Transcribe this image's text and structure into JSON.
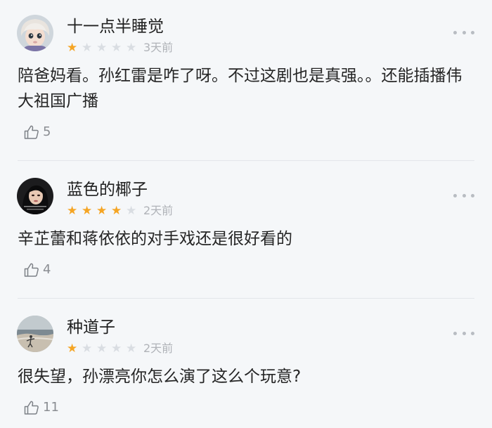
{
  "reviews": [
    {
      "username": "十一点半睡觉",
      "rating": 1,
      "max_rating": 5,
      "time": "3天前",
      "content": "陪爸妈看。孙红雷是咋了呀。不过这剧也是真强。。还能插播伟大祖国广播",
      "likes": "5",
      "avatar_icon": "doll-avatar"
    },
    {
      "username": "蓝色的椰子",
      "rating": 4,
      "max_rating": 5,
      "time": "2天前",
      "content": "辛芷蕾和蒋依依的对手戏还是很好看的",
      "likes": "4",
      "avatar_icon": "portrait-avatar"
    },
    {
      "username": "种道子",
      "rating": 1,
      "max_rating": 5,
      "time": "2天前",
      "content": "很失望，孙漂亮你怎么演了这么个玩意?",
      "likes": "11",
      "avatar_icon": "beach-avatar"
    }
  ],
  "colors": {
    "background": "#f5f7f9",
    "star_filled": "#f5a524",
    "star_empty": "#d9dde2",
    "meta_text": "#b0b3b8"
  }
}
